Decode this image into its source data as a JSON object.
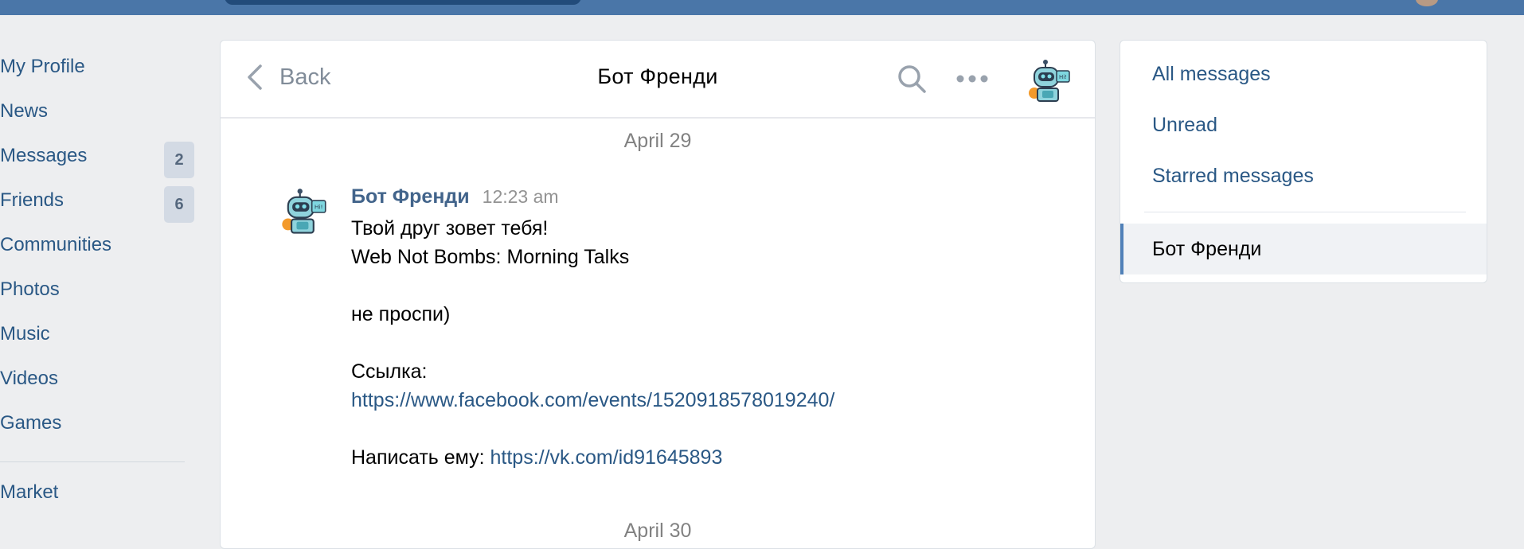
{
  "nav": {
    "items": [
      {
        "label": "My Profile"
      },
      {
        "label": "News"
      },
      {
        "label": "Messages",
        "badge": "2"
      },
      {
        "label": "Friends",
        "badge": "6"
      },
      {
        "label": "Communities"
      },
      {
        "label": "Photos"
      },
      {
        "label": "Music"
      },
      {
        "label": "Videos"
      },
      {
        "label": "Games"
      }
    ],
    "market": "Market"
  },
  "chat": {
    "back_label": "Back",
    "title": "Бот Френди",
    "date": "April 29",
    "next_date": "April 30",
    "message": {
      "author": "Бот Френди",
      "time": "12:23 am",
      "line1": "Твой друг зовет тебя!",
      "line2": "Web Not Bombs: Morning Talks",
      "line3": "не проспи)",
      "line4": "Ссылка:",
      "link1": "https://www.facebook.com/events/1520918578019240/",
      "write_prefix": "Написать ему: ",
      "link2": "https://vk.com/id91645893"
    }
  },
  "right": {
    "all_messages": "All messages",
    "unread": "Unread",
    "starred": "Starred messages",
    "active_chat": "Бот Френди"
  },
  "colors": {
    "header_blue": "#4a76a8",
    "link_blue": "#2a5885",
    "author_blue": "#42648b",
    "badge_bg": "#d3dae4",
    "active_border": "#5181b8"
  },
  "icons": {
    "back": "chevron-left-icon",
    "search": "search-icon",
    "more": "more-dots-icon",
    "avatar": "robot-avatar-icon"
  }
}
